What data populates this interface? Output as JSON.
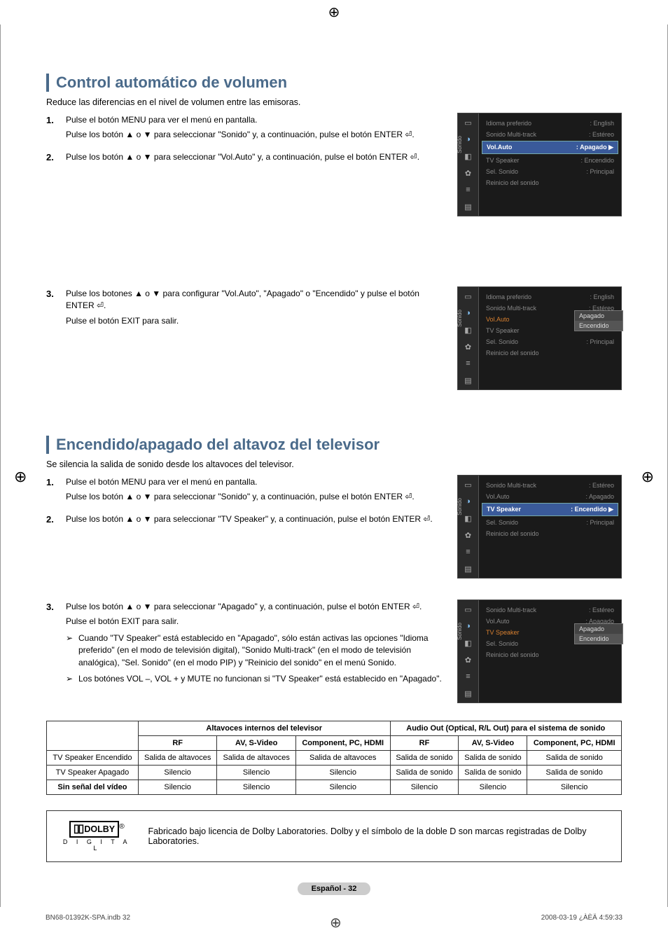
{
  "section1": {
    "title": "Control automático de volumen",
    "intro": "Reduce las diferencias en el nivel de volumen entre las emisoras.",
    "steps": [
      {
        "num": "1.",
        "lines": [
          "Pulse el botón MENU para ver el menú en pantalla.",
          "Pulse los botón ▲ o ▼ para seleccionar \"Sonido\" y, a continuación, pulse el botón ENTER ⏎."
        ]
      },
      {
        "num": "2.",
        "lines": [
          "Pulse los botón ▲ o ▼ para seleccionar \"Vol.Auto\" y, a continuación, pulse el botón ENTER ⏎."
        ]
      },
      {
        "num": "3.",
        "lines": [
          "Pulse los botones ▲ o ▼ para configurar \"Vol.Auto\", \"Apagado\" o \"Encendido\" y pulse el botón ENTER ⏎.",
          "Pulse el botón EXIT para salir."
        ]
      }
    ]
  },
  "section2": {
    "title": "Encendido/apagado del altavoz del televisor",
    "intro": "Se silencia la salida de sonido desde los altavoces del televisor.",
    "steps": [
      {
        "num": "1.",
        "lines": [
          "Pulse el botón MENU para ver el menú en pantalla.",
          "Pulse los botón ▲ o ▼ para seleccionar \"Sonido\" y, a continuación, pulse el botón ENTER ⏎."
        ]
      },
      {
        "num": "2.",
        "lines": [
          "Pulse los botón ▲ o ▼ para seleccionar \"TV Speaker\" y, a continuación, pulse el botón ENTER ⏎."
        ]
      },
      {
        "num": "3.",
        "lines": [
          "Pulse los botón ▲ o ▼ para seleccionar \"Apagado\" y, a continuación, pulse el botón ENTER ⏎.",
          "Pulse el botón EXIT para salir."
        ],
        "subs": [
          "Cuando \"TV Speaker\" está establecido en \"Apagado\", sólo están activas las opciones \"Idioma preferido\" (en el modo de televisión digital), \"Sonido Multi-track\" (en el modo de televisión analógica), \"Sel. Sonido\" (en el modo PIP) y \"Reinicio del sonido\" en el menú Sonido.",
          "Los botónes VOL –, VOL + y MUTE no funcionan si \"TV Speaker\" está establecido en \"Apagado\"."
        ]
      }
    ]
  },
  "menus": {
    "sidebar_label": "Sonido",
    "m1": [
      {
        "l": "Idioma preferido",
        "r": ": English"
      },
      {
        "l": "Sonido Multi-track",
        "r": ": Estéreo"
      },
      {
        "l": "Vol.Auto",
        "r": ": Apagado",
        "hi": true,
        "tri": true
      },
      {
        "l": "TV Speaker",
        "r": ": Encendido"
      },
      {
        "l": "Sel. Sonido",
        "r": ": Principal"
      },
      {
        "l": "Reinicio del sonido",
        "r": ""
      }
    ],
    "m2": [
      {
        "l": "Idioma preferido",
        "r": ": English"
      },
      {
        "l": "Sonido Multi-track",
        "r": ": Estéreo"
      },
      {
        "l": "Vol.Auto",
        "r": "",
        "orange": true
      },
      {
        "l": "TV Speaker",
        "r": ""
      },
      {
        "l": "Sel. Sonido",
        "r": ": Principal"
      },
      {
        "l": "Reinicio del sonido",
        "r": ""
      }
    ],
    "m2_dropdown": [
      "Apagado",
      "Encendido"
    ],
    "m3": [
      {
        "l": "Sonido Multi-track",
        "r": ": Estéreo"
      },
      {
        "l": "Vol.Auto",
        "r": ": Apagado"
      },
      {
        "l": "TV Speaker",
        "r": ": Encendido",
        "hi": true,
        "tri": true
      },
      {
        "l": "Sel. Sonido",
        "r": ": Principal"
      },
      {
        "l": "Reinicio del sonido",
        "r": ""
      }
    ],
    "m4": [
      {
        "l": "Sonido Multi-track",
        "r": ": Estéreo"
      },
      {
        "l": "Vol.Auto",
        "r": ": Apagado"
      },
      {
        "l": "TV Speaker",
        "r": "",
        "orange": true
      },
      {
        "l": "Sel. Sonido",
        "r": ""
      },
      {
        "l": "Reinicio del sonido",
        "r": ""
      }
    ],
    "m4_dropdown": [
      "Apagado",
      "Encendido"
    ]
  },
  "table": {
    "h_internal": "Altavoces internos del televisor",
    "h_audioout": "Audio Out (Optical, R/L Out) para el sistema de sonido",
    "sub": [
      "RF",
      "AV, S-Video",
      "Component, PC, HDMI",
      "RF",
      "AV, S-Video",
      "Component, PC, HDMI"
    ],
    "rows": [
      {
        "h": "TV Speaker Encendido",
        "c": [
          "Salida de altavoces",
          "Salida de altavoces",
          "Salida de altavoces",
          "Salida de sonido",
          "Salida de sonido",
          "Salida de sonido"
        ]
      },
      {
        "h": "TV Speaker Apagado",
        "c": [
          "Silencio",
          "Silencio",
          "Silencio",
          "Salida de sonido",
          "Salida de sonido",
          "Salida de sonido"
        ]
      },
      {
        "h": "Sin señal del vídeo",
        "bold": true,
        "c": [
          "Silencio",
          "Silencio",
          "Silencio",
          "Silencio",
          "Silencio",
          "Silencio"
        ]
      }
    ]
  },
  "dolby": {
    "brand": "DOLBY",
    "sym": "▯▯",
    "digital": "D I G I T A L",
    "reg": "®",
    "text": "Fabricado bajo licencia de Dolby Laboratories. Dolby y el símbolo de la doble D son marcas registradas de Dolby Laboratories."
  },
  "footer": {
    "page": "Español - 32"
  },
  "printline": {
    "left": "BN68-01392K-SPA.indb   32",
    "right": "2008-03-19   ¿ÀÈÄ 4:59:33"
  }
}
